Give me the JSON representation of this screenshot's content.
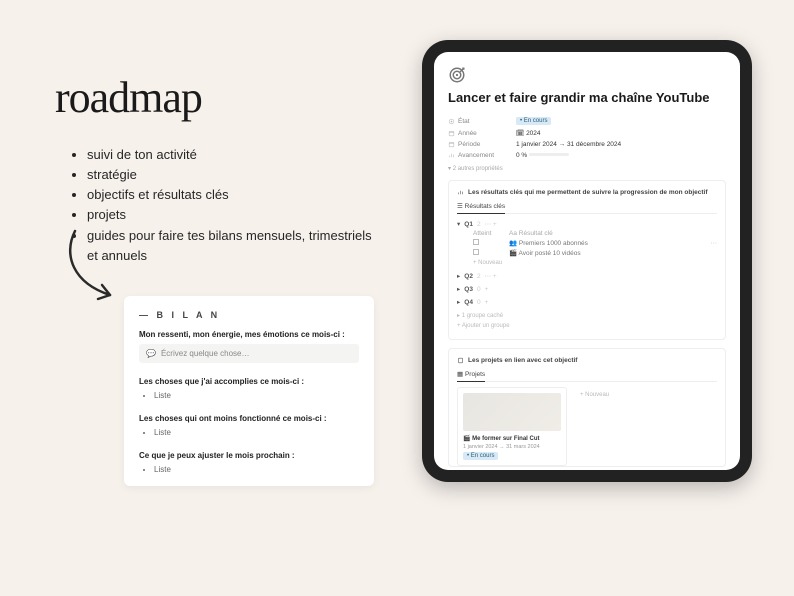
{
  "left": {
    "headline": "roadmap",
    "bullets": [
      "suivi de ton activité",
      "stratégie",
      "objectifs et résultats clés",
      "projets",
      "guides pour faire tes bilans mensuels, trimestriels et annuels"
    ]
  },
  "bilan": {
    "title": "— B I L A N",
    "q1_label": "Mon ressenti, mon énergie, mes émotions ce mois-ci :",
    "q1_placeholder": "Écrivez quelque chose…",
    "q2_label": "Les choses que j'ai accomplies ce mois-ci :",
    "q3_label": "Les choses qui ont moins fonctionné ce mois-ci :",
    "q4_label": "Ce que je peux ajuster le mois prochain :",
    "list_item": "Liste"
  },
  "tablet": {
    "page_title": "Lancer et faire grandir ma chaîne YouTube",
    "props": {
      "etat_label": "État",
      "etat_value": "• En cours",
      "annee_label": "Année",
      "annee_value": "2024",
      "periode_label": "Période",
      "periode_value": "1 janvier 2024 → 31 décembre 2024",
      "avancement_label": "Avancement",
      "avancement_value": "0 %"
    },
    "more_props": "2 autres propriétés",
    "results": {
      "heading": "Les résultats clés qui me permettent de suivre la progression de mon objectif",
      "tab": "Résultats clés",
      "col_a": "Atteint",
      "col_b": "Résultat clé",
      "q1_label": "Q1",
      "q1_count": "2",
      "q1_items": [
        "Premiers 1000 abonnés",
        "Avoir posté 10 vidéos"
      ],
      "q2_label": "Q2",
      "q2_count": "2",
      "q3_label": "Q3",
      "q3_count": "0",
      "q4_label": "Q4",
      "q4_count": "0",
      "new": "+  Nouveau",
      "hidden": "1 groupe caché",
      "add_group": "+  Ajouter un groupe"
    },
    "projects": {
      "heading": "Les projets en lien avec cet objectif",
      "tab": "Projets",
      "card_title": "Me former sur Final Cut",
      "card_dates": "1 janvier 2024 → 31 mars 2024",
      "card_status": "• En cours",
      "add": "+  Nouveau"
    }
  }
}
